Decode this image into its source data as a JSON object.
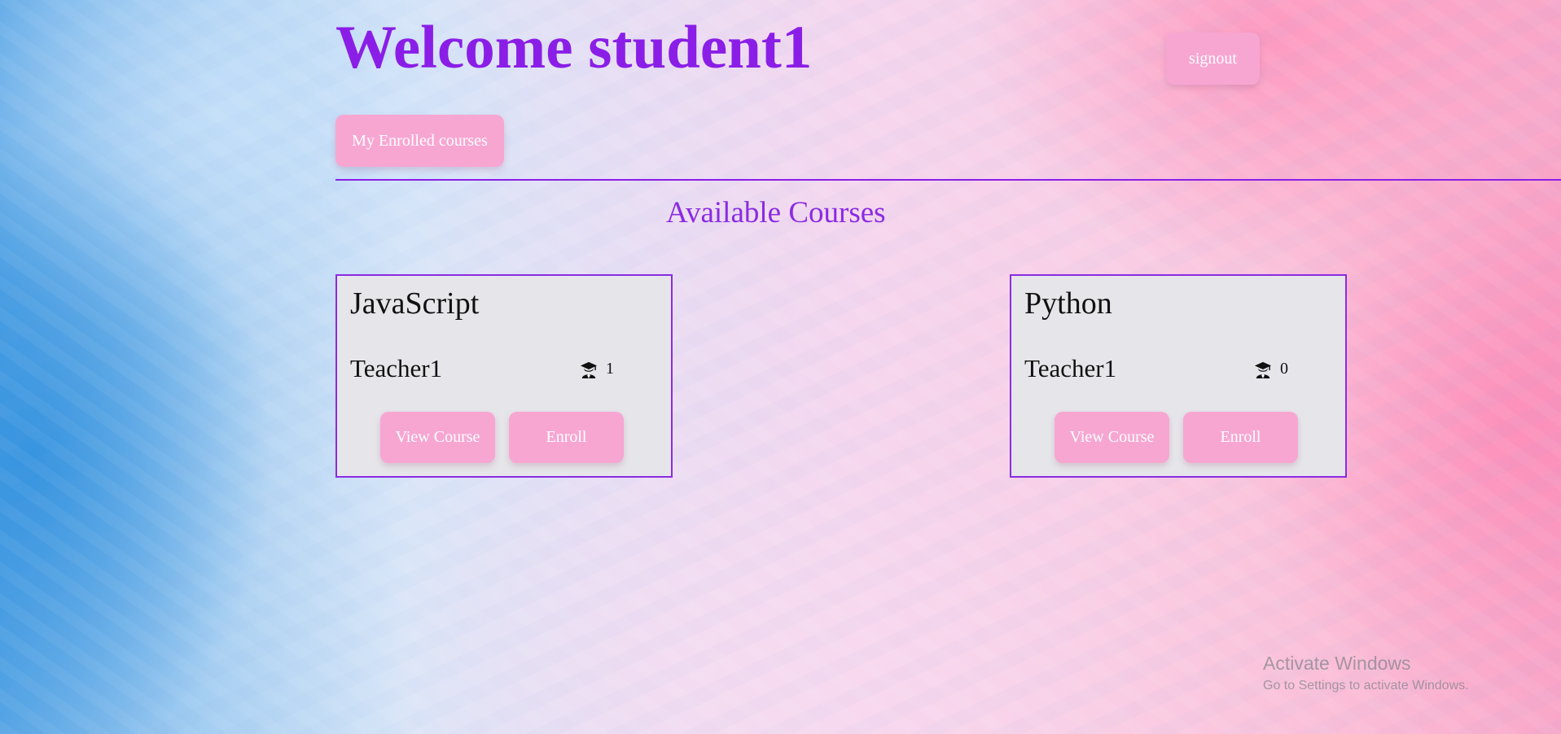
{
  "header": {
    "welcome_text": "Welcome student1",
    "signout_label": "signout",
    "enrolled_label": "My Enrolled courses"
  },
  "main": {
    "section_title": "Available Courses",
    "courses": [
      {
        "title": "JavaScript",
        "teacher": "Teacher1",
        "students_icon": "graduate-icon",
        "students_count": "1",
        "view_label": "View Course",
        "enroll_label": "Enroll"
      },
      {
        "title": "Python",
        "teacher": "Teacher1",
        "students_icon": "graduate-icon",
        "students_count": "0",
        "view_label": "View Course",
        "enroll_label": "Enroll"
      }
    ]
  },
  "os_overlay": {
    "title": "Activate Windows",
    "subtitle": "Go to Settings to activate Windows."
  },
  "colors": {
    "accent": "#8a1ee6",
    "button_bg": "#f7a6d2",
    "button_text": "#ffffff",
    "card_bg": "#e6e6ea"
  }
}
